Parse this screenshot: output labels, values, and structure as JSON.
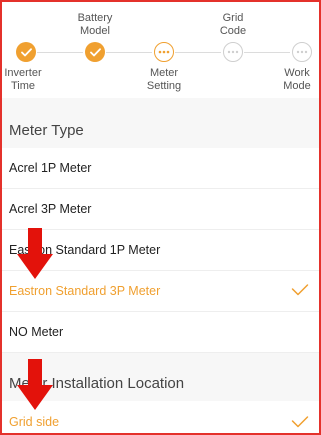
{
  "wizard": {
    "steps": [
      {
        "label": "Inverter\nTime",
        "state": "done"
      },
      {
        "label": "Battery\nModel",
        "state": "done"
      },
      {
        "label": "Meter\nSetting",
        "state": "current"
      },
      {
        "label": "Grid\nCode",
        "state": "todo"
      },
      {
        "label": "Work\nMode",
        "state": "todo"
      }
    ]
  },
  "meter_type": {
    "title": "Meter Type",
    "options": [
      {
        "label": "Acrel 1P Meter",
        "selected": false
      },
      {
        "label": "Acrel 3P Meter",
        "selected": false
      },
      {
        "label": "Eastron Standard 1P Meter",
        "selected": false
      },
      {
        "label": "Eastron Standard 3P Meter",
        "selected": true
      },
      {
        "label": "NO Meter",
        "selected": false
      }
    ]
  },
  "installation": {
    "title": "Meter Installation Location",
    "options": [
      {
        "label": "Grid side",
        "selected": true
      }
    ]
  },
  "colors": {
    "accent": "#f0a030",
    "annotation_arrow": "#e3120b",
    "frame": "#e4312b"
  },
  "icons": {
    "done": "check-icon",
    "current": "dots-icon",
    "todo": "dots-icon",
    "selected": "checkmark-icon",
    "annotation": "down-arrow-icon"
  }
}
